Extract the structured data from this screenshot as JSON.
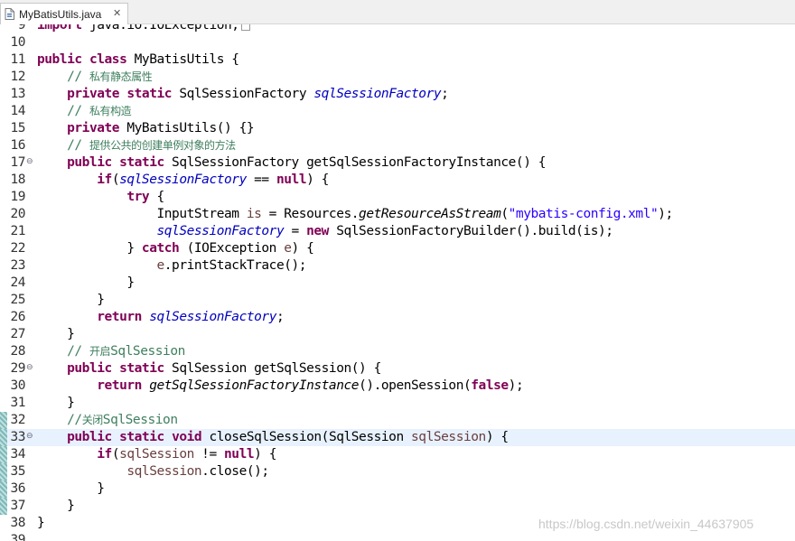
{
  "tab": {
    "title": "MyBatisUtils.java",
    "close_glyph": "✕",
    "icon": "java-file-icon"
  },
  "lines": [
    {
      "n": "9",
      "tokens": [
        [
          "kw",
          "import"
        ],
        [
          "dflt",
          " java.io.IOException;"
        ]
      ],
      "collapsed": true
    },
    {
      "n": "10",
      "tokens": []
    },
    {
      "n": "11",
      "tokens": [
        [
          "kw",
          "public"
        ],
        [
          "dflt",
          " "
        ],
        [
          "kw",
          "class"
        ],
        [
          "dflt",
          " MyBatisUtils {"
        ]
      ]
    },
    {
      "n": "12",
      "tokens": [
        [
          "dflt",
          "    "
        ],
        [
          "cm",
          "// "
        ],
        [
          "cmcn",
          "私有静态属性"
        ]
      ]
    },
    {
      "n": "13",
      "tokens": [
        [
          "dflt",
          "    "
        ],
        [
          "kw",
          "private"
        ],
        [
          "dflt",
          " "
        ],
        [
          "kw",
          "static"
        ],
        [
          "dflt",
          " SqlSessionFactory "
        ],
        [
          "fs",
          "sqlSessionFactory"
        ],
        [
          "dflt",
          ";"
        ]
      ]
    },
    {
      "n": "14",
      "tokens": [
        [
          "dflt",
          "    "
        ],
        [
          "cm",
          "// "
        ],
        [
          "cmcn",
          "私有构造"
        ]
      ]
    },
    {
      "n": "15",
      "tokens": [
        [
          "dflt",
          "    "
        ],
        [
          "kw",
          "private"
        ],
        [
          "dflt",
          " MyBatisUtils() {}"
        ]
      ]
    },
    {
      "n": "16",
      "tokens": [
        [
          "dflt",
          "    "
        ],
        [
          "cm",
          "// "
        ],
        [
          "cmcn",
          "提供公共的创建单例对象的方法"
        ]
      ]
    },
    {
      "n": "17",
      "fold": true,
      "tokens": [
        [
          "dflt",
          "    "
        ],
        [
          "kw",
          "public"
        ],
        [
          "dflt",
          " "
        ],
        [
          "kw",
          "static"
        ],
        [
          "dflt",
          " SqlSessionFactory getSqlSessionFactoryInstance() {"
        ]
      ]
    },
    {
      "n": "18",
      "tokens": [
        [
          "dflt",
          "        "
        ],
        [
          "kw",
          "if"
        ],
        [
          "dflt",
          "("
        ],
        [
          "fs",
          "sqlSessionFactory"
        ],
        [
          "dflt",
          " == "
        ],
        [
          "kw",
          "null"
        ],
        [
          "dflt",
          ") {"
        ]
      ]
    },
    {
      "n": "19",
      "tokens": [
        [
          "dflt",
          "            "
        ],
        [
          "kw",
          "try"
        ],
        [
          "dflt",
          " {"
        ]
      ]
    },
    {
      "n": "20",
      "tokens": [
        [
          "dflt",
          "                InputStream "
        ],
        [
          "lv",
          "is"
        ],
        [
          "dflt",
          " = Resources."
        ],
        [
          "it",
          "getResourceAsStream"
        ],
        [
          "dflt",
          "("
        ],
        [
          "st",
          "\"mybatis-config.xml\""
        ],
        [
          "dflt",
          ");"
        ]
      ]
    },
    {
      "n": "21",
      "tokens": [
        [
          "dflt",
          "                "
        ],
        [
          "fs",
          "sqlSessionFactory"
        ],
        [
          "dflt",
          " = "
        ],
        [
          "kw",
          "new"
        ],
        [
          "dflt",
          " SqlSessionFactoryBuilder().build(is);"
        ]
      ]
    },
    {
      "n": "22",
      "tokens": [
        [
          "dflt",
          "            } "
        ],
        [
          "kw",
          "catch"
        ],
        [
          "dflt",
          " (IOException "
        ],
        [
          "lv",
          "e"
        ],
        [
          "dflt",
          ") {"
        ]
      ]
    },
    {
      "n": "23",
      "tokens": [
        [
          "dflt",
          "                "
        ],
        [
          "lv",
          "e"
        ],
        [
          "dflt",
          ".printStackTrace();"
        ]
      ]
    },
    {
      "n": "24",
      "tokens": [
        [
          "dflt",
          "            }"
        ]
      ]
    },
    {
      "n": "25",
      "tokens": [
        [
          "dflt",
          "        }"
        ]
      ]
    },
    {
      "n": "26",
      "tokens": [
        [
          "dflt",
          "        "
        ],
        [
          "kw",
          "return"
        ],
        [
          "dflt",
          " "
        ],
        [
          "fs",
          "sqlSessionFactory"
        ],
        [
          "dflt",
          ";"
        ]
      ]
    },
    {
      "n": "27",
      "tokens": [
        [
          "dflt",
          "    }"
        ]
      ]
    },
    {
      "n": "28",
      "tokens": [
        [
          "dflt",
          "    "
        ],
        [
          "cm",
          "// "
        ],
        [
          "cmcn",
          "开启"
        ],
        [
          "cm",
          "SqlSession"
        ]
      ]
    },
    {
      "n": "29",
      "fold": true,
      "tokens": [
        [
          "dflt",
          "    "
        ],
        [
          "kw",
          "public"
        ],
        [
          "dflt",
          " "
        ],
        [
          "kw",
          "static"
        ],
        [
          "dflt",
          " SqlSession getSqlSession() {"
        ]
      ]
    },
    {
      "n": "30",
      "tokens": [
        [
          "dflt",
          "        "
        ],
        [
          "kw",
          "return"
        ],
        [
          "dflt",
          " "
        ],
        [
          "it",
          "getSqlSessionFactoryInstance"
        ],
        [
          "dflt",
          "().openSession("
        ],
        [
          "kw",
          "false"
        ],
        [
          "dflt",
          ");"
        ]
      ]
    },
    {
      "n": "31",
      "tokens": [
        [
          "dflt",
          "    }"
        ]
      ]
    },
    {
      "n": "32",
      "marker": true,
      "tokens": [
        [
          "dflt",
          "    "
        ],
        [
          "cm",
          "//"
        ],
        [
          "cmcn",
          "关闭"
        ],
        [
          "cm",
          "SqlSession"
        ]
      ]
    },
    {
      "n": "33",
      "marker": true,
      "fold": true,
      "current": true,
      "tokens": [
        [
          "dflt",
          "    "
        ],
        [
          "kw",
          "public"
        ],
        [
          "dflt",
          " "
        ],
        [
          "kw",
          "static"
        ],
        [
          "dflt",
          " "
        ],
        [
          "kw",
          "void"
        ],
        [
          "dflt",
          " closeSqlSession(SqlSession "
        ],
        [
          "lv",
          "sqlSession"
        ],
        [
          "dflt",
          ") {"
        ]
      ]
    },
    {
      "n": "34",
      "marker": true,
      "tokens": [
        [
          "dflt",
          "        "
        ],
        [
          "kw",
          "if"
        ],
        [
          "dflt",
          "("
        ],
        [
          "lv",
          "sqlSession"
        ],
        [
          "dflt",
          " != "
        ],
        [
          "kw",
          "null"
        ],
        [
          "dflt",
          ") {"
        ]
      ]
    },
    {
      "n": "35",
      "marker": true,
      "tokens": [
        [
          "dflt",
          "            "
        ],
        [
          "lv",
          "sqlSession"
        ],
        [
          "dflt",
          ".close();"
        ]
      ]
    },
    {
      "n": "36",
      "marker": true,
      "tokens": [
        [
          "dflt",
          "        }"
        ]
      ]
    },
    {
      "n": "37",
      "marker": true,
      "tokens": [
        [
          "dflt",
          "    }"
        ]
      ]
    },
    {
      "n": "38",
      "tokens": [
        [
          "dflt",
          "}"
        ]
      ]
    },
    {
      "n": "39",
      "tokens": []
    }
  ],
  "watermark": "https://blog.csdn.net/weixin_44637905",
  "colors": {
    "keyword": "#7f0055",
    "field": "#0000c0",
    "comment": "#3f7f5f",
    "string": "#2a00ff",
    "current_line": "#e8f2fe"
  }
}
